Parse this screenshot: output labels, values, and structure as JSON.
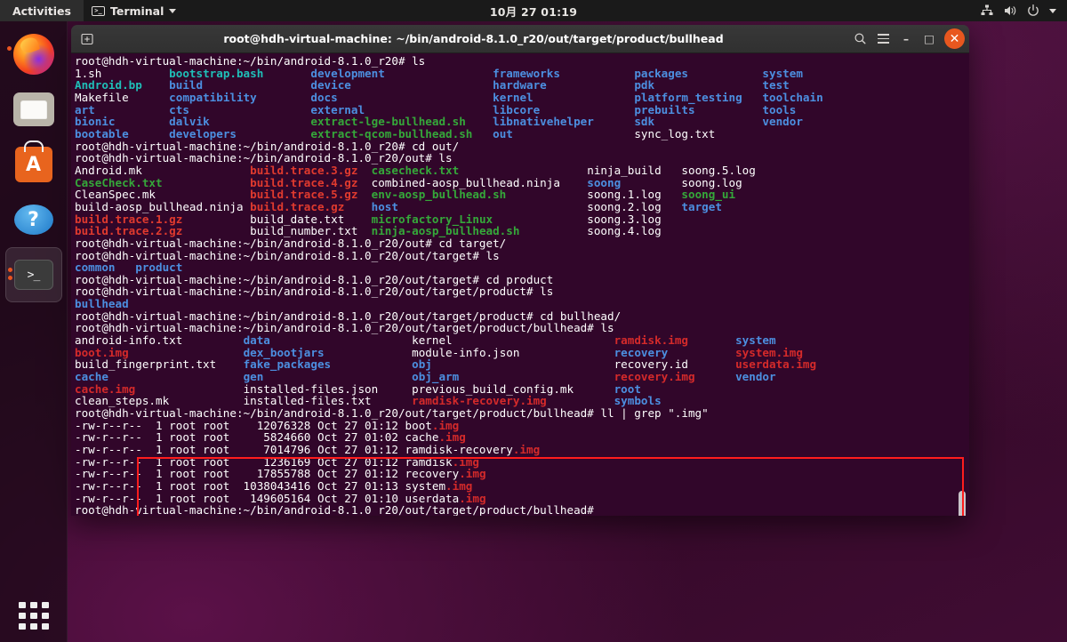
{
  "topbar": {
    "activities_label": "Activities",
    "app_menu_label": "Terminal",
    "app_menu_icon": "terminal-icon",
    "clock": "10月 27  01:19",
    "indicators": [
      {
        "name": "network-icon"
      },
      {
        "name": "volume-icon"
      },
      {
        "name": "power-icon"
      },
      {
        "name": "chevron-down-icon"
      }
    ]
  },
  "dock": {
    "items": [
      {
        "name": "firefox",
        "label": "Firefox",
        "icon": "firefox-icon",
        "running": true,
        "active": false
      },
      {
        "name": "files",
        "label": "Files",
        "icon": "files-icon",
        "running": false,
        "active": false
      },
      {
        "name": "software",
        "label": "Ubuntu Software",
        "icon": "ubuntu-software-icon",
        "glyph": "A",
        "running": false,
        "active": false
      },
      {
        "name": "help",
        "label": "Help",
        "icon": "help-icon",
        "glyph": "?",
        "running": false,
        "active": false
      },
      {
        "name": "terminal",
        "label": "Terminal",
        "icon": "terminal-icon",
        "glyph": ">_",
        "running": true,
        "active": true
      }
    ],
    "show_apps_label": "Show Applications"
  },
  "window": {
    "title": "root@hdh-virtual-machine: ~/bin/android-8.1.0_r20/out/target/product/bullhead",
    "new_tab_icon": "new-tab-icon",
    "search_icon": "search-icon",
    "menu_icon": "hamburger-menu-icon",
    "minimize_label": "–",
    "maximize_label": "□",
    "close_label": "✕"
  },
  "terminal": {
    "background_color": "#31062a",
    "highlight_color": "#ff1d1d",
    "colors": {
      "directory": "#4c8fe0",
      "executable": "#35a83a",
      "archive": "#e03a2e",
      "image_file": "#d42a2a",
      "regular_file": "#ffffff",
      "prompt": "#ffffff",
      "teal": "#1fbfb8"
    },
    "prompts": {
      "root_dir": "root@hdh-virtual-machine:~/bin/android-8.1.0_r20# ",
      "out_dir": "root@hdh-virtual-machine:~/bin/android-8.1.0_r20/out# ",
      "target_dir": "root@hdh-virtual-machine:~/bin/android-8.1.0_r20/out/target# ",
      "product_dir": "root@hdh-virtual-machine:~/bin/android-8.1.0_r20/out/target/product# ",
      "bullhead_dir": "root@hdh-virtual-machine:~/bin/android-8.1.0_r20/out/target/product/bullhead# "
    },
    "commands": {
      "ls": "ls",
      "cd_out": "cd out/",
      "cd_target": "cd target/",
      "cd_product": "cd product",
      "cd_bullhead": "cd bullhead/",
      "grep_img": "ll | grep \".img\""
    },
    "ls_root": [
      [
        {
          "t": "1.sh",
          "c": "file"
        },
        {
          "t": "bootstrap.bash",
          "c": "teal"
        },
        {
          "t": "development",
          "c": "dir"
        },
        {
          "t": "frameworks",
          "c": "dir"
        },
        {
          "t": "packages",
          "c": "dir"
        },
        {
          "t": "system",
          "c": "dir"
        }
      ],
      [
        {
          "t": "Android.bp",
          "c": "teal"
        },
        {
          "t": "build",
          "c": "dir"
        },
        {
          "t": "device",
          "c": "dir"
        },
        {
          "t": "hardware",
          "c": "dir"
        },
        {
          "t": "pdk",
          "c": "dir"
        },
        {
          "t": "test",
          "c": "dir"
        }
      ],
      [
        {
          "t": "Makefile",
          "c": "file"
        },
        {
          "t": "compatibility",
          "c": "dir"
        },
        {
          "t": "docs",
          "c": "dir"
        },
        {
          "t": "kernel",
          "c": "dir"
        },
        {
          "t": "platform_testing",
          "c": "dir"
        },
        {
          "t": "toolchain",
          "c": "dir"
        }
      ],
      [
        {
          "t": "art",
          "c": "dir"
        },
        {
          "t": "cts",
          "c": "dir"
        },
        {
          "t": "external",
          "c": "dir"
        },
        {
          "t": "libcore",
          "c": "dir"
        },
        {
          "t": "prebuilts",
          "c": "dir"
        },
        {
          "t": "tools",
          "c": "dir"
        }
      ],
      [
        {
          "t": "bionic",
          "c": "dir"
        },
        {
          "t": "dalvik",
          "c": "dir"
        },
        {
          "t": "extract-lge-bullhead.sh",
          "c": "exec"
        },
        {
          "t": "libnativehelper",
          "c": "dir"
        },
        {
          "t": "sdk",
          "c": "dir"
        },
        {
          "t": "vendor",
          "c": "dir"
        }
      ],
      [
        {
          "t": "bootable",
          "c": "dir"
        },
        {
          "t": "developers",
          "c": "dir"
        },
        {
          "t": "extract-qcom-bullhead.sh",
          "c": "exec"
        },
        {
          "t": "out",
          "c": "dir"
        },
        {
          "t": "sync_log.txt",
          "c": "file"
        }
      ]
    ],
    "ls_out": [
      [
        {
          "t": "Android.mk",
          "c": "file"
        },
        {
          "t": "build.trace.3.gz",
          "c": "arch"
        },
        {
          "t": "casecheck.txt",
          "c": "exec"
        },
        {
          "t": "ninja_build",
          "c": "file"
        },
        {
          "t": "soong.5.log",
          "c": "file"
        }
      ],
      [
        {
          "t": "CaseCheck.txt",
          "c": "exec"
        },
        {
          "t": "build.trace.4.gz",
          "c": "arch"
        },
        {
          "t": "combined-aosp_bullhead.ninja",
          "c": "file"
        },
        {
          "t": "soong",
          "c": "dir"
        },
        {
          "t": "soong.log",
          "c": "file"
        }
      ],
      [
        {
          "t": "CleanSpec.mk",
          "c": "file"
        },
        {
          "t": "build.trace.5.gz",
          "c": "arch"
        },
        {
          "t": "env-aosp_bullhead.sh",
          "c": "exec"
        },
        {
          "t": "soong.1.log",
          "c": "file"
        },
        {
          "t": "soong_ui",
          "c": "exec"
        }
      ],
      [
        {
          "t": "build-aosp_bullhead.ninja",
          "c": "file"
        },
        {
          "t": "build.trace.gz",
          "c": "arch"
        },
        {
          "t": "host",
          "c": "dir"
        },
        {
          "t": "soong.2.log",
          "c": "file"
        },
        {
          "t": "target",
          "c": "dir"
        }
      ],
      [
        {
          "t": "build.trace.1.gz",
          "c": "arch"
        },
        {
          "t": "build_date.txt",
          "c": "file"
        },
        {
          "t": "microfactory_Linux",
          "c": "exec"
        },
        {
          "t": "soong.3.log",
          "c": "file"
        }
      ],
      [
        {
          "t": "build.trace.2.gz",
          "c": "arch"
        },
        {
          "t": "build_number.txt",
          "c": "file"
        },
        {
          "t": "ninja-aosp_bullhead.sh",
          "c": "exec"
        },
        {
          "t": "soong.4.log",
          "c": "file"
        }
      ]
    ],
    "ls_target": [
      {
        "t": "common",
        "c": "dir"
      },
      {
        "t": "product",
        "c": "dir"
      }
    ],
    "ls_product": [
      {
        "t": "bullhead",
        "c": "dir"
      }
    ],
    "ls_bullhead": [
      [
        {
          "t": "android-info.txt",
          "c": "file"
        },
        {
          "t": "data",
          "c": "dir"
        },
        {
          "t": "kernel",
          "c": "file"
        },
        {
          "t": "ramdisk.img",
          "c": "img"
        },
        {
          "t": "system",
          "c": "dir"
        }
      ],
      [
        {
          "t": "boot.img",
          "c": "img"
        },
        {
          "t": "dex_bootjars",
          "c": "dir"
        },
        {
          "t": "module-info.json",
          "c": "file"
        },
        {
          "t": "recovery",
          "c": "dir"
        },
        {
          "t": "system.img",
          "c": "img"
        }
      ],
      [
        {
          "t": "build_fingerprint.txt",
          "c": "file"
        },
        {
          "t": "fake_packages",
          "c": "dir"
        },
        {
          "t": "obj",
          "c": "dir"
        },
        {
          "t": "recovery.id",
          "c": "file"
        },
        {
          "t": "userdata.img",
          "c": "img"
        }
      ],
      [
        {
          "t": "cache",
          "c": "dir"
        },
        {
          "t": "gen",
          "c": "dir"
        },
        {
          "t": "obj_arm",
          "c": "dir"
        },
        {
          "t": "recovery.img",
          "c": "img"
        },
        {
          "t": "vendor",
          "c": "dir"
        }
      ],
      [
        {
          "t": "cache.img",
          "c": "img"
        },
        {
          "t": "installed-files.json",
          "c": "file"
        },
        {
          "t": "previous_build_config.mk",
          "c": "file"
        },
        {
          "t": "root",
          "c": "dir"
        }
      ],
      [
        {
          "t": "clean_steps.mk",
          "c": "file"
        },
        {
          "t": "installed-files.txt",
          "c": "file"
        },
        {
          "t": "ramdisk-recovery.img",
          "c": "img"
        },
        {
          "t": "symbols",
          "c": "dir"
        }
      ]
    ],
    "grep_results": {
      "columns": [
        "permissions",
        "links",
        "owner",
        "group",
        "size",
        "month",
        "day",
        "time",
        "name"
      ],
      "rows": [
        {
          "permissions": "-rw-r--r--",
          "links": "1",
          "owner": "root",
          "group": "root",
          "size": "12076328",
          "month": "Oct",
          "day": "27",
          "time": "01:12",
          "stem": "boot",
          "ext": ".img"
        },
        {
          "permissions": "-rw-r--r--",
          "links": "1",
          "owner": "root",
          "group": "root",
          "size": "5824660",
          "month": "Oct",
          "day": "27",
          "time": "01:02",
          "stem": "cache",
          "ext": ".img"
        },
        {
          "permissions": "-rw-r--r--",
          "links": "1",
          "owner": "root",
          "group": "root",
          "size": "7014796",
          "month": "Oct",
          "day": "27",
          "time": "01:12",
          "stem": "ramdisk-recovery",
          "ext": ".img"
        },
        {
          "permissions": "-rw-r--r--",
          "links": "1",
          "owner": "root",
          "group": "root",
          "size": "1236169",
          "month": "Oct",
          "day": "27",
          "time": "01:12",
          "stem": "ramdisk",
          "ext": ".img"
        },
        {
          "permissions": "-rw-r--r--",
          "links": "1",
          "owner": "root",
          "group": "root",
          "size": "17855788",
          "month": "Oct",
          "day": "27",
          "time": "01:12",
          "stem": "recovery",
          "ext": ".img"
        },
        {
          "permissions": "-rw-r--r--",
          "links": "1",
          "owner": "root",
          "group": "root",
          "size": "1038043416",
          "month": "Oct",
          "day": "27",
          "time": "01:13",
          "stem": "system",
          "ext": ".img"
        },
        {
          "permissions": "-rw-r--r--",
          "links": "1",
          "owner": "root",
          "group": "root",
          "size": "149605164",
          "month": "Oct",
          "day": "27",
          "time": "01:10",
          "stem": "userdata",
          "ext": ".img"
        }
      ]
    }
  }
}
